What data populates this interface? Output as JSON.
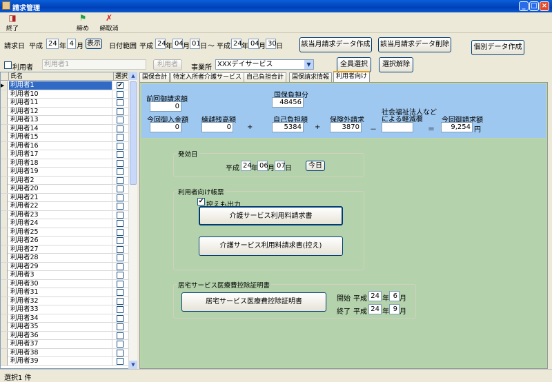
{
  "window": {
    "title": "請求管理"
  },
  "toolbar": {
    "exit": "終了",
    "close": "締め",
    "uncommit": "締取消"
  },
  "header": {
    "billing_label": "請求日",
    "era": "平成",
    "year": "24",
    "year_unit": "年",
    "month": "4",
    "month_unit": "月",
    "show_button": "表示",
    "range_label": "日付範囲",
    "from_era": "平成",
    "from_year": "24",
    "from_month": "04",
    "from_day": "01",
    "tilde": "～",
    "to_era": "平成",
    "to_year": "24",
    "to_month": "04",
    "to_day": "30",
    "year_ch": "年",
    "month_ch": "月",
    "day_ch": "日",
    "create_btn": "該当月請求データ作成",
    "delete_btn": "該当月請求データ削除",
    "individual_btn": "個別データ作成"
  },
  "filter": {
    "user_check_label": "利用者",
    "user_placeholder": "利用者1",
    "user_button": "利用者",
    "office_label": "事業所",
    "office_value": "XXXデイサービス",
    "select_all": "全員選択",
    "deselect": "選択解除"
  },
  "list": {
    "col_name": "氏名",
    "col_select": "選択",
    "check": "✔",
    "rows": [
      "利用者1",
      "利用者10",
      "利用者11",
      "利用者12",
      "利用者13",
      "利用者14",
      "利用者15",
      "利用者16",
      "利用者17",
      "利用者18",
      "利用者19",
      "利用者2",
      "利用者20",
      "利用者21",
      "利用者22",
      "利用者23",
      "利用者24",
      "利用者25",
      "利用者26",
      "利用者27",
      "利用者28",
      "利用者29",
      "利用者3",
      "利用者30",
      "利用者31",
      "利用者32",
      "利用者33",
      "利用者34",
      "利用者35",
      "利用者36",
      "利用者37",
      "利用者38",
      "利用者39"
    ]
  },
  "tabs": [
    "国保合計",
    "特定入所者介護サービス",
    "自己負担合計",
    "国保請求情報",
    "利用者向け"
  ],
  "summary": {
    "prev_label": "前回御請求額",
    "prev_value": "0",
    "kokuho_label": "国保負担分",
    "kokuho_value": "48456",
    "received_label": "今回御入金額",
    "received_value": "0",
    "carry_label": "繰越残高額",
    "carry_value": "0",
    "self_label": "自己負担額",
    "self_value": "5384",
    "plus1": "+",
    "plus2": "+",
    "outside_label": "保険外請求",
    "outside_value": "3870",
    "minus": "－",
    "social_label1": "社会福祉法人など",
    "social_label2": "による軽減欄",
    "social_value": "",
    "eq": "＝",
    "total_label": "今回御請求額",
    "total_value": "9,254",
    "yen": "円"
  },
  "issue": {
    "group": "発効日",
    "era": "平成",
    "year": "24",
    "month": "06",
    "day": "07",
    "y": "年",
    "m": "月",
    "d": "日",
    "today": "今日"
  },
  "forms": {
    "group": "利用者向け帳票",
    "copy_check": "控えも出力",
    "btn1": "介護サービス利用料請求書",
    "btn2": "介護サービス利用料請求書(控え)"
  },
  "medical": {
    "group": "居宅サービス医療費控除証明書",
    "btn": "居宅サービス医療費控除証明書",
    "start": "開始",
    "end": "終了",
    "era": "平成",
    "start_year": "24",
    "start_month": "6",
    "end_year": "24",
    "end_month": "9",
    "y": "年",
    "m": "月"
  },
  "status": {
    "text": "選択1 件"
  }
}
